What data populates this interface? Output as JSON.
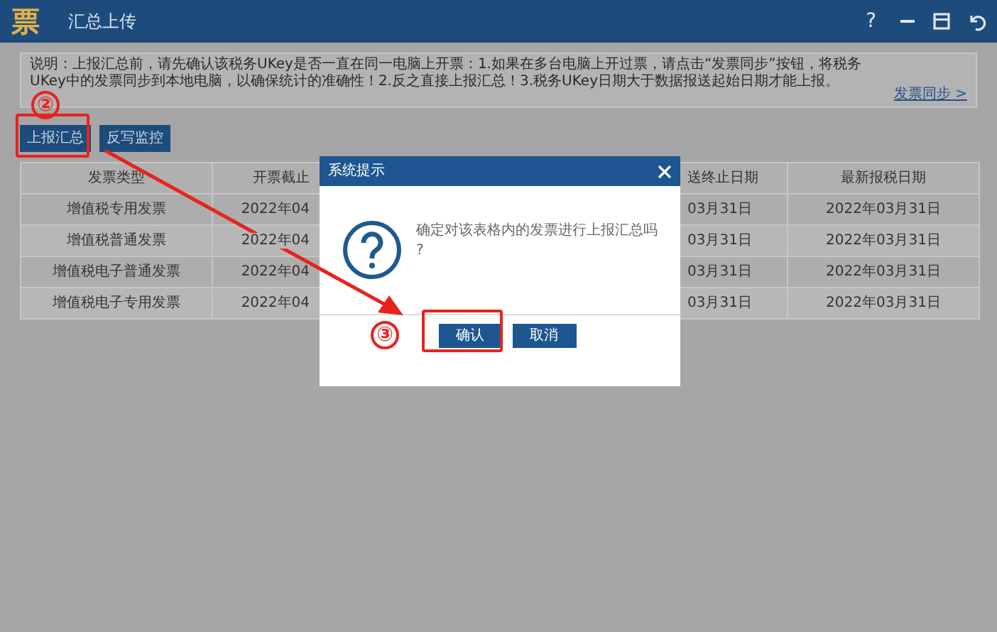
{
  "window": {
    "logo": "票",
    "title": "汇总上传",
    "help": "?"
  },
  "notice": {
    "text": "说明：上报汇总前，请先确认该税务UKey是否一直在同一电脑上开票：1.如果在多台电脑上开过票，请点击“发票同步”按钮，将税务UKey中的发票同步到本地电脑，以确保统计的准确性！2.反之直接上报汇总！3.税务UKey日期大于数据报送起始日期才能上报。",
    "link": "发票同步 >"
  },
  "buttons": [
    "上报汇总",
    "反写监控"
  ],
  "table": {
    "columns": [
      "发票类型",
      "开票截止",
      "",
      "送终止日期",
      "最新报税日期"
    ],
    "rows": [
      [
        "增值税专用发票",
        "2022年04",
        "",
        "03月31日",
        "2022年03月31日"
      ],
      [
        "增值税普通发票",
        "2022年04",
        "",
        "03月31日",
        "2022年03月31日"
      ],
      [
        "增值税电子普通发票",
        "2022年04",
        "",
        "03月31日",
        "2022年03月31日"
      ],
      [
        "增值税电子专用发票",
        "2022年04",
        "",
        "03月31日",
        "2022年03月31日"
      ]
    ]
  },
  "dialog": {
    "title": "系统提示",
    "message": "确定对该表格内的发票进行上报汇总吗",
    "message_tail": "?",
    "buttons": [
      "确认",
      "取消"
    ]
  },
  "annotations": [
    {
      "kind": "step",
      "text": "②"
    },
    {
      "kind": "step",
      "text": "③"
    }
  ]
}
